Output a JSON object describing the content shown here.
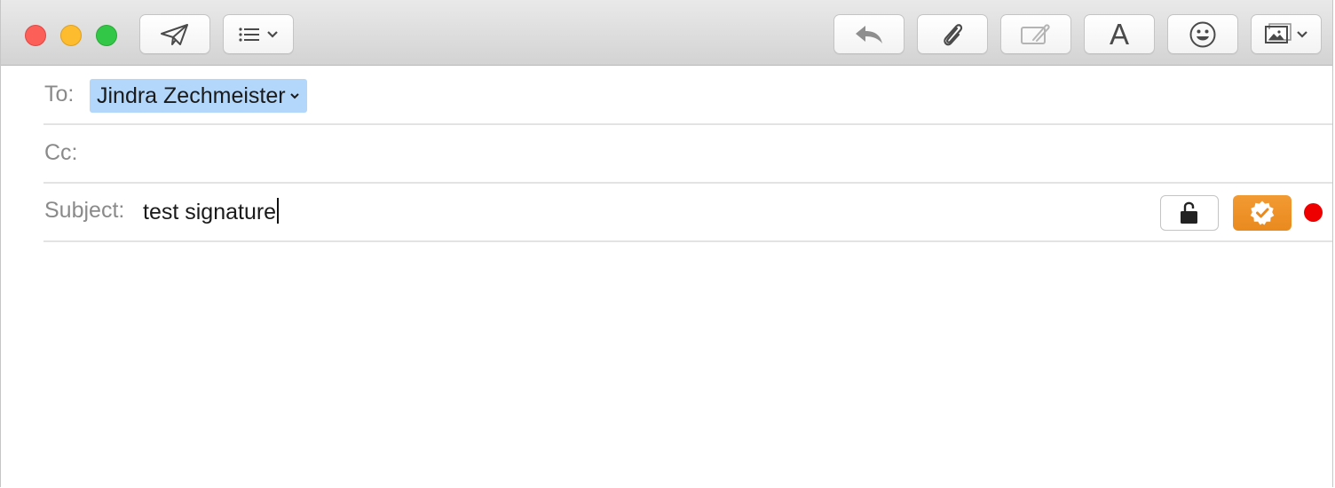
{
  "toolbar": {
    "send_icon": "paper-plane-icon",
    "header_fields_icon": "list-icon",
    "reply_icon": "reply-arrow-icon",
    "attach_icon": "paperclip-icon",
    "annotate_icon": "markup-icon",
    "format_label": "A",
    "emoji_icon": "smiley-icon",
    "photo_icon": "photo-browser-icon"
  },
  "compose": {
    "to_label": "To:",
    "to_recipient": "Jindra Zechmeister",
    "cc_label": "Cc:",
    "cc_value": "",
    "subject_label": "Subject:",
    "subject_value": "test signature"
  },
  "security": {
    "encrypt_icon": "unlocked-padlock-icon",
    "sign_icon": "verified-badge-icon",
    "sign_color": "#e98a1e",
    "status_color": "#ee0000"
  },
  "colors": {
    "recipient_token": "#b3d6fb",
    "close": "#fc5f57",
    "minimize": "#fdbc2e",
    "zoom": "#33c748"
  }
}
